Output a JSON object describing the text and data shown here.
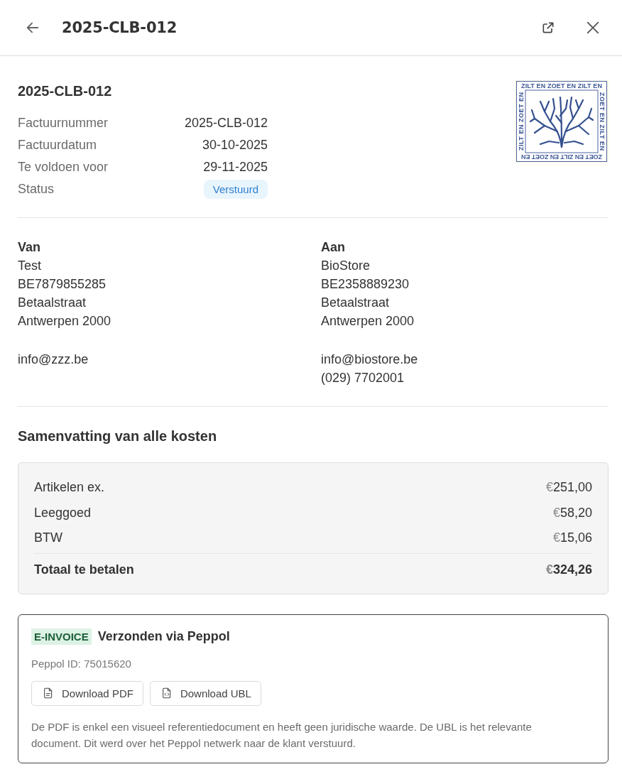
{
  "header": {
    "title": "2025-CLB-012"
  },
  "invoice": {
    "title": "2025-CLB-012",
    "fields": [
      {
        "label": "Factuurnummer",
        "value": "2025-CLB-012",
        "kind": "text"
      },
      {
        "label": "Factuurdatum",
        "value": "30-10-2025",
        "kind": "text"
      },
      {
        "label": "Te voldoen voor",
        "value": "29-11-2025",
        "kind": "text"
      },
      {
        "label": "Status",
        "value": "Verstuurd",
        "kind": "badge"
      }
    ]
  },
  "logo": {
    "border_texts": [
      "ZILT EN ZOET EN ZILT EN",
      "ZOET EN ZILT EN",
      "ZOET EN ZILT EN ZOET EN",
      "ZILT EN ZOET EN"
    ]
  },
  "parties": [
    {
      "heading": "Van",
      "lines": [
        "Test",
        "BE7879855285",
        "Betaalstraat",
        "Antwerpen 2000"
      ],
      "contact": [
        "info@zzz.be"
      ]
    },
    {
      "heading": "Aan",
      "lines": [
        "BioStore",
        "BE2358889230",
        "Betaalstraat",
        "Antwerpen 2000"
      ],
      "contact": [
        "info@biostore.be",
        "(029) 7702001"
      ]
    }
  ],
  "summary": {
    "title": "Samenvatting van alle kosten",
    "rows": [
      {
        "label": "Artikelen ex.",
        "currency": "€",
        "amount": "251,00"
      },
      {
        "label": "Leeggoed",
        "currency": "€",
        "amount": "58,20"
      },
      {
        "label": "BTW",
        "currency": "€",
        "amount": "15,06"
      }
    ],
    "total": {
      "label": "Totaal te betalen",
      "currency": "€",
      "amount": "324,26"
    }
  },
  "einvoice": {
    "badge": "E-INVOICE",
    "title": "Verzonden via Peppol",
    "peppol_id": "Peppol ID: 75015620",
    "buttons": [
      {
        "label": "Download PDF",
        "kind": "pdf"
      },
      {
        "label": "Download UBL",
        "kind": "code"
      }
    ],
    "note": "De PDF is enkel een visueel referentiedocument en heeft geen juridische waarde. De UBL is het relevante document. Dit werd over het Peppol netwerk naar de klant verstuurd."
  }
}
